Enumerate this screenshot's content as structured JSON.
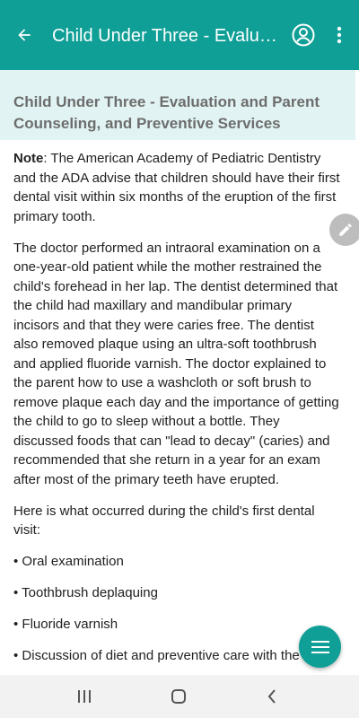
{
  "app_bar": {
    "title": "Child Under Three - Evaluation and Parent Counseling, and Preventive Services",
    "icons": {
      "back": "arrow-back-icon",
      "account": "account-circle-icon",
      "more": "more-vert-icon"
    },
    "color": "#0f9f96"
  },
  "section": {
    "heading": "Child Under Three - Evaluation and Parent Counseling, and Preventive Services",
    "background": "#e1f4f3"
  },
  "content": {
    "note_label": "Note",
    "note_text": ": The American Academy of Pediatric Dentistry and the ADA advise that children should have their first dental visit within six months of the eruption of the first primary tooth.",
    "paragraph_1": "The doctor performed an intraoral examination on a one-year-old patient while the mother restrained the child's forehead in her lap. The dentist determined that the child had maxillary and mandibular primary incisors and that they were caries free. The dentist also removed plaque using an ultra-soft toothbrush and applied fluoride varnish. The doctor explained to the parent how to use a washcloth or soft brush to remove plaque each day and the importance of getting the child to go to sleep without a bottle. They discussed foods that can \"lead to decay\" (caries) and recommended that she return in a year for an exam after most of the primary teeth have erupted.",
    "paragraph_2": "Here is what occurred during the child's first dental visit:",
    "bullets": [
      "• Oral examination",
      "• Toothbrush deplaquing",
      "• Fluoride varnish",
      "• Discussion of diet and preventive care with the"
    ]
  },
  "fabs": {
    "edit": "edit-pencil-icon",
    "menu": "menu-lines-icon"
  },
  "nav_bar": {
    "recents": "recents-icon",
    "home": "home-icon",
    "back": "nav-back-icon"
  }
}
